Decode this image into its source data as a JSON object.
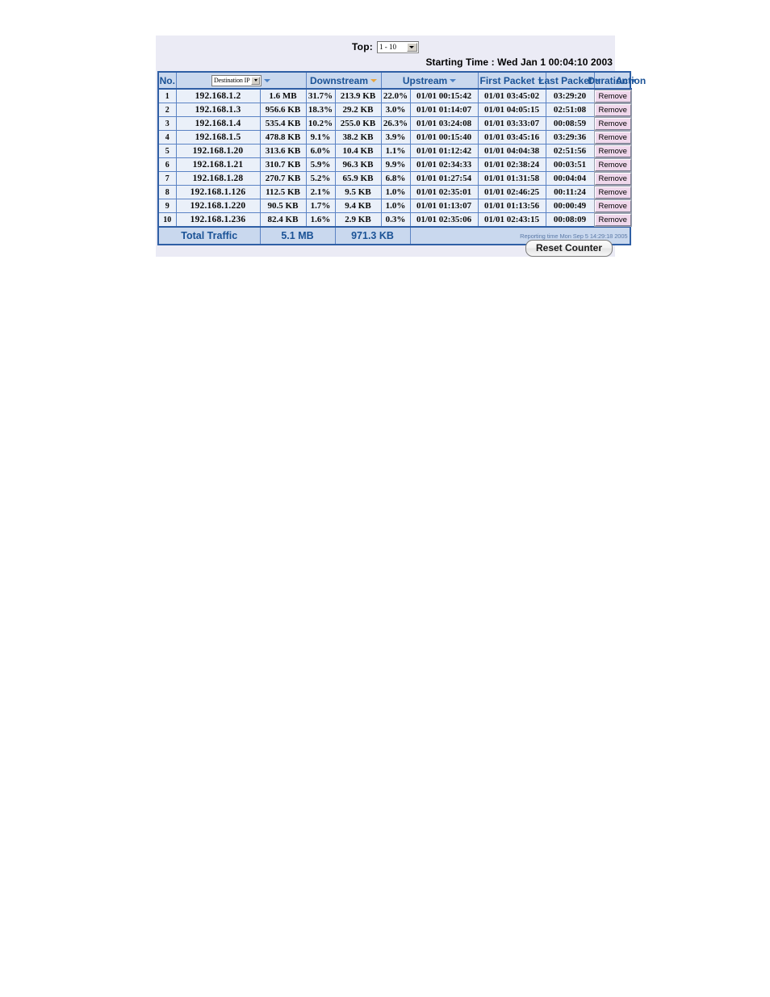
{
  "controls": {
    "top_label": "Top:",
    "top_select_value": "1 - 10",
    "starting_time": "Starting Time : Wed Jan 1 00:04:10 2003"
  },
  "table": {
    "headers": {
      "no": "No.",
      "ip_select_value": "Destination IP",
      "downstream": "Downstream",
      "upstream": "Upstream",
      "first_packet": "First Packet",
      "last_packet": "Last Packet",
      "duration": "Duration",
      "action": "Action"
    },
    "rows": [
      {
        "no": "1",
        "ip": "192.168.1.2",
        "downstream": "1.6 MB",
        "downstream_pct": "31.7%",
        "upstream": "213.9 KB",
        "upstream_pct": "22.0%",
        "first_packet": "01/01 00:15:42",
        "last_packet": "01/01 03:45:02",
        "duration": "03:29:20",
        "action": "Remove"
      },
      {
        "no": "2",
        "ip": "192.168.1.3",
        "downstream": "956.6 KB",
        "downstream_pct": "18.3%",
        "upstream": "29.2 KB",
        "upstream_pct": "3.0%",
        "first_packet": "01/01 01:14:07",
        "last_packet": "01/01 04:05:15",
        "duration": "02:51:08",
        "action": "Remove"
      },
      {
        "no": "3",
        "ip": "192.168.1.4",
        "downstream": "535.4 KB",
        "downstream_pct": "10.2%",
        "upstream": "255.0 KB",
        "upstream_pct": "26.3%",
        "first_packet": "01/01 03:24:08",
        "last_packet": "01/01 03:33:07",
        "duration": "00:08:59",
        "action": "Remove"
      },
      {
        "no": "4",
        "ip": "192.168.1.5",
        "downstream": "478.8 KB",
        "downstream_pct": "9.1%",
        "upstream": "38.2 KB",
        "upstream_pct": "3.9%",
        "first_packet": "01/01 00:15:40",
        "last_packet": "01/01 03:45:16",
        "duration": "03:29:36",
        "action": "Remove"
      },
      {
        "no": "5",
        "ip": "192.168.1.20",
        "downstream": "313.6 KB",
        "downstream_pct": "6.0%",
        "upstream": "10.4 KB",
        "upstream_pct": "1.1%",
        "first_packet": "01/01 01:12:42",
        "last_packet": "01/01 04:04:38",
        "duration": "02:51:56",
        "action": "Remove"
      },
      {
        "no": "6",
        "ip": "192.168.1.21",
        "downstream": "310.7 KB",
        "downstream_pct": "5.9%",
        "upstream": "96.3 KB",
        "upstream_pct": "9.9%",
        "first_packet": "01/01 02:34:33",
        "last_packet": "01/01 02:38:24",
        "duration": "00:03:51",
        "action": "Remove"
      },
      {
        "no": "7",
        "ip": "192.168.1.28",
        "downstream": "270.7 KB",
        "downstream_pct": "5.2%",
        "upstream": "65.9 KB",
        "upstream_pct": "6.8%",
        "first_packet": "01/01 01:27:54",
        "last_packet": "01/01 01:31:58",
        "duration": "00:04:04",
        "action": "Remove"
      },
      {
        "no": "8",
        "ip": "192.168.1.126",
        "downstream": "112.5 KB",
        "downstream_pct": "2.1%",
        "upstream": "9.5 KB",
        "upstream_pct": "1.0%",
        "first_packet": "01/01 02:35:01",
        "last_packet": "01/01 02:46:25",
        "duration": "00:11:24",
        "action": "Remove"
      },
      {
        "no": "9",
        "ip": "192.168.1.220",
        "downstream": "90.5 KB",
        "downstream_pct": "1.7%",
        "upstream": "9.4 KB",
        "upstream_pct": "1.0%",
        "first_packet": "01/01 01:13:07",
        "last_packet": "01/01 01:13:56",
        "duration": "00:00:49",
        "action": "Remove"
      },
      {
        "no": "10",
        "ip": "192.168.1.236",
        "downstream": "82.4 KB",
        "downstream_pct": "1.6%",
        "upstream": "2.9 KB",
        "upstream_pct": "0.3%",
        "first_packet": "01/01 02:35:06",
        "last_packet": "01/01 02:43:15",
        "duration": "00:08:09",
        "action": "Remove"
      }
    ],
    "total": {
      "label": "Total Traffic",
      "downstream": "5.1 MB",
      "upstream": "971.3 KB",
      "reporting_time": "Reporting time Mon Sep 5 14:29:18 2005"
    }
  },
  "footer": {
    "reset_label": "Reset Counter"
  },
  "colors": {
    "panel_bg": "#ebebf5",
    "header_bg": "#c9d8ee",
    "header_text": "#1a5296",
    "cell_bg": "#eaf0f9",
    "border": "#2f5fa5",
    "active_sort": "#e8a33d",
    "remove_bg": "#f0d8ec"
  }
}
